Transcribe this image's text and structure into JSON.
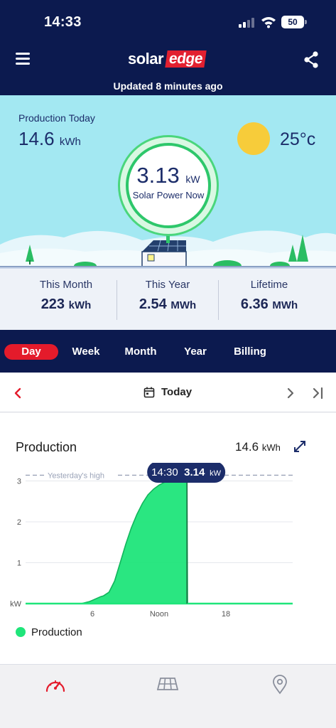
{
  "status_bar": {
    "time": "14:33",
    "battery": "50"
  },
  "header": {
    "logo_left": "solar",
    "logo_right": "edge",
    "updated": "Updated 8 minutes ago"
  },
  "hero": {
    "production_today_label": "Production Today",
    "production_today_value": "14.6",
    "production_today_unit": "kWh",
    "temperature": "25°c",
    "power_now_value": "3.13",
    "power_now_unit": "kW",
    "power_now_label": "Solar Power Now"
  },
  "stats": [
    {
      "label": "This Month",
      "value": "223",
      "unit": "kWh"
    },
    {
      "label": "This Year",
      "value": "2.54",
      "unit": "MWh"
    },
    {
      "label": "Lifetime",
      "value": "6.36",
      "unit": "MWh"
    }
  ],
  "tabs": [
    {
      "label": "Day",
      "active": true
    },
    {
      "label": "Week",
      "active": false
    },
    {
      "label": "Month",
      "active": false
    },
    {
      "label": "Year",
      "active": false
    },
    {
      "label": "Billing",
      "active": false
    }
  ],
  "date_nav": {
    "label": "Today"
  },
  "card": {
    "title": "Production",
    "total_value": "14.6",
    "total_unit": "kWh",
    "legend": "Production"
  },
  "colors": {
    "navy": "#0c1a4f",
    "accent_red": "#e41b2b",
    "production_green": "#1fe57a",
    "sky": "#a3e8f2"
  },
  "icons": {
    "menu": "menu-icon",
    "share": "share-icon",
    "calendar": "calendar-icon",
    "expand": "expand-icon",
    "dashboard": "dashboard-icon",
    "layout": "solar-panel-icon",
    "location": "location-pin-icon"
  },
  "chart_data": {
    "type": "area",
    "title": "Production",
    "ylabel": "kW",
    "ylim": [
      0,
      3.2
    ],
    "yticks": [
      1,
      2,
      3
    ],
    "x_tick_labels": [
      {
        "hour": 6,
        "label": "6"
      },
      {
        "hour": 12,
        "label": "Noon"
      },
      {
        "hour": 18,
        "label": "18"
      }
    ],
    "xlim": [
      0,
      24
    ],
    "reference_line": {
      "label": "Yesterday's high",
      "value": 3.14
    },
    "tooltip": {
      "time": "14:30",
      "value": "3.14",
      "unit": "kW"
    },
    "series": [
      {
        "name": "Production",
        "x": [
          0,
          5.0,
          5.75,
          6.25,
          6.75,
          7.0,
          7.5,
          8.0,
          8.5,
          9.0,
          9.5,
          10.0,
          10.5,
          11.0,
          11.5,
          12.0,
          12.5,
          13.0,
          13.5,
          14.0,
          14.5,
          14.55,
          24
        ],
        "y": [
          0,
          0,
          0.05,
          0.11,
          0.17,
          0.19,
          0.28,
          0.55,
          1.0,
          1.45,
          1.85,
          2.18,
          2.45,
          2.66,
          2.8,
          2.9,
          2.97,
          3.03,
          3.07,
          3.1,
          3.14,
          0,
          0
        ]
      }
    ]
  }
}
